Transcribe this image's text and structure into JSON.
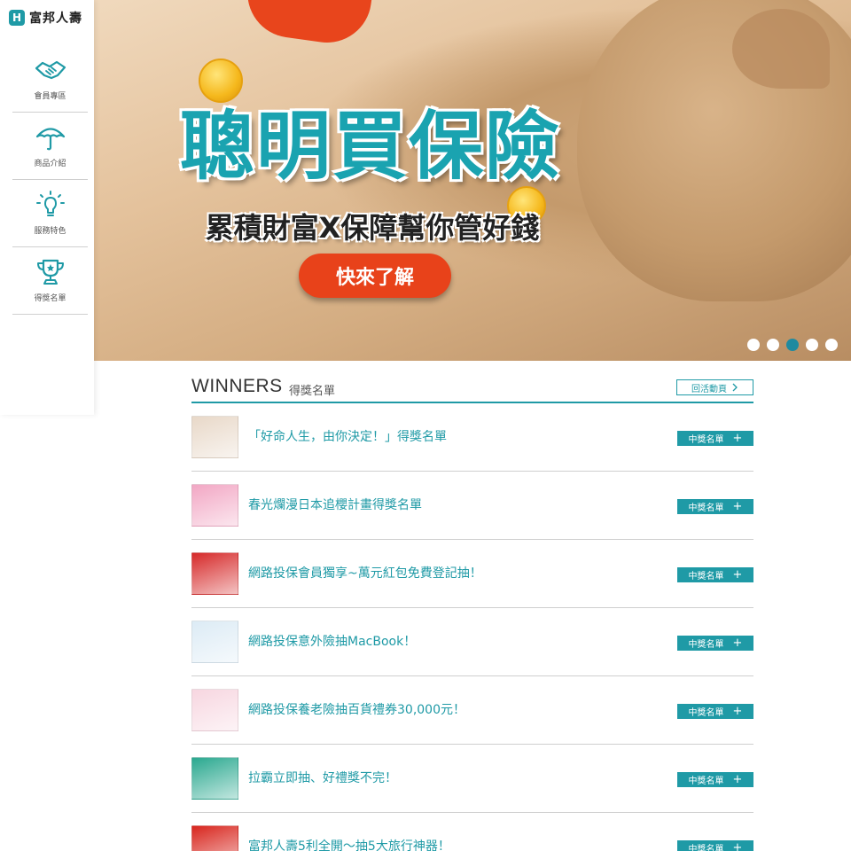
{
  "logo": {
    "mark": "H",
    "text": "富邦人壽"
  },
  "sidebar": {
    "items": [
      {
        "label": "會員專區",
        "icon": "handshake-icon"
      },
      {
        "label": "商品介紹",
        "icon": "umbrella-icon"
      },
      {
        "label": "服務特色",
        "icon": "lightbulb-icon"
      },
      {
        "label": "得獎名單",
        "icon": "trophy-icon"
      }
    ]
  },
  "banner": {
    "headline": "聰明買保險",
    "subline": "累積財富X保障幫你管好錢",
    "cta": "快來了解",
    "active_slide": 3,
    "slide_count": 5
  },
  "winners": {
    "title": "WINNERS",
    "subtitle": "得獎名單",
    "back_label": "回活動頁",
    "back_icon": "chevron-right-icon",
    "button_label": "中獎名單",
    "button_icon": "plus-icon",
    "items": [
      {
        "text": "「好命人生，由你決定！」得獎名單",
        "thumb_color": "#e8d8c8"
      },
      {
        "text": "春光爛漫日本追櫻計畫得獎名單",
        "thumb_color": "#f2a7c4"
      },
      {
        "text": "網路投保會員獨享~萬元紅包免費登記抽！",
        "thumb_color": "#d62a2a"
      },
      {
        "text": "網路投保意外險抽MacBook！",
        "thumb_color": "#dcebf5"
      },
      {
        "text": "網路投保養老險抽百貨禮券30,000元！",
        "thumb_color": "#f7d6e0"
      },
      {
        "text": "拉霸立即抽、好禮獎不完！",
        "thumb_color": "#2aa88f"
      },
      {
        "text": "富邦人壽5利全開～抽5大旅行神器！",
        "thumb_color": "#d8261e"
      }
    ]
  },
  "colors": {
    "accent": "#1f9aa6",
    "cta": "#e8421a"
  }
}
